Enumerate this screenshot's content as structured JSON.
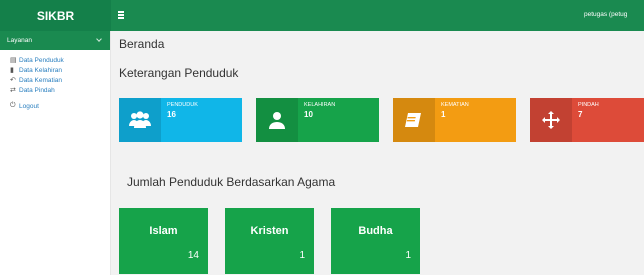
{
  "header": {
    "brand": "SIKBR",
    "user": "petugas (petug"
  },
  "sidebar": {
    "section_label": "Layanan",
    "items": [
      {
        "label": "Data Penduduk",
        "icon": "id-card-icon"
      },
      {
        "label": "Data Kelahiran",
        "icon": "book-icon"
      },
      {
        "label": "Data Kematian",
        "icon": "undo-icon"
      },
      {
        "label": "Data Pindah",
        "icon": "transfer-icon"
      }
    ],
    "logout": "Logout"
  },
  "main": {
    "page_title": "Beranda",
    "section_title": "Keterangan Penduduk",
    "stats": [
      {
        "label": "PENDUDUK",
        "value": "16",
        "color": "#10b6e8",
        "icon": "users-icon"
      },
      {
        "label": "KELAHIRAN",
        "value": "10",
        "color": "#16a34a",
        "icon": "user-icon"
      },
      {
        "label": "KEMATIAN",
        "value": "1",
        "color": "#f39c12",
        "icon": "note-icon"
      },
      {
        "label": "PINDAH",
        "value": "7",
        "color": "#dd4b39",
        "icon": "move-icon"
      }
    ],
    "agama_title": "Jumlah Penduduk Berdasarkan Agama",
    "agama": [
      {
        "name": "Islam",
        "count": "14"
      },
      {
        "name": "Kristen",
        "count": "1"
      },
      {
        "name": "Budha",
        "count": "1"
      }
    ]
  }
}
